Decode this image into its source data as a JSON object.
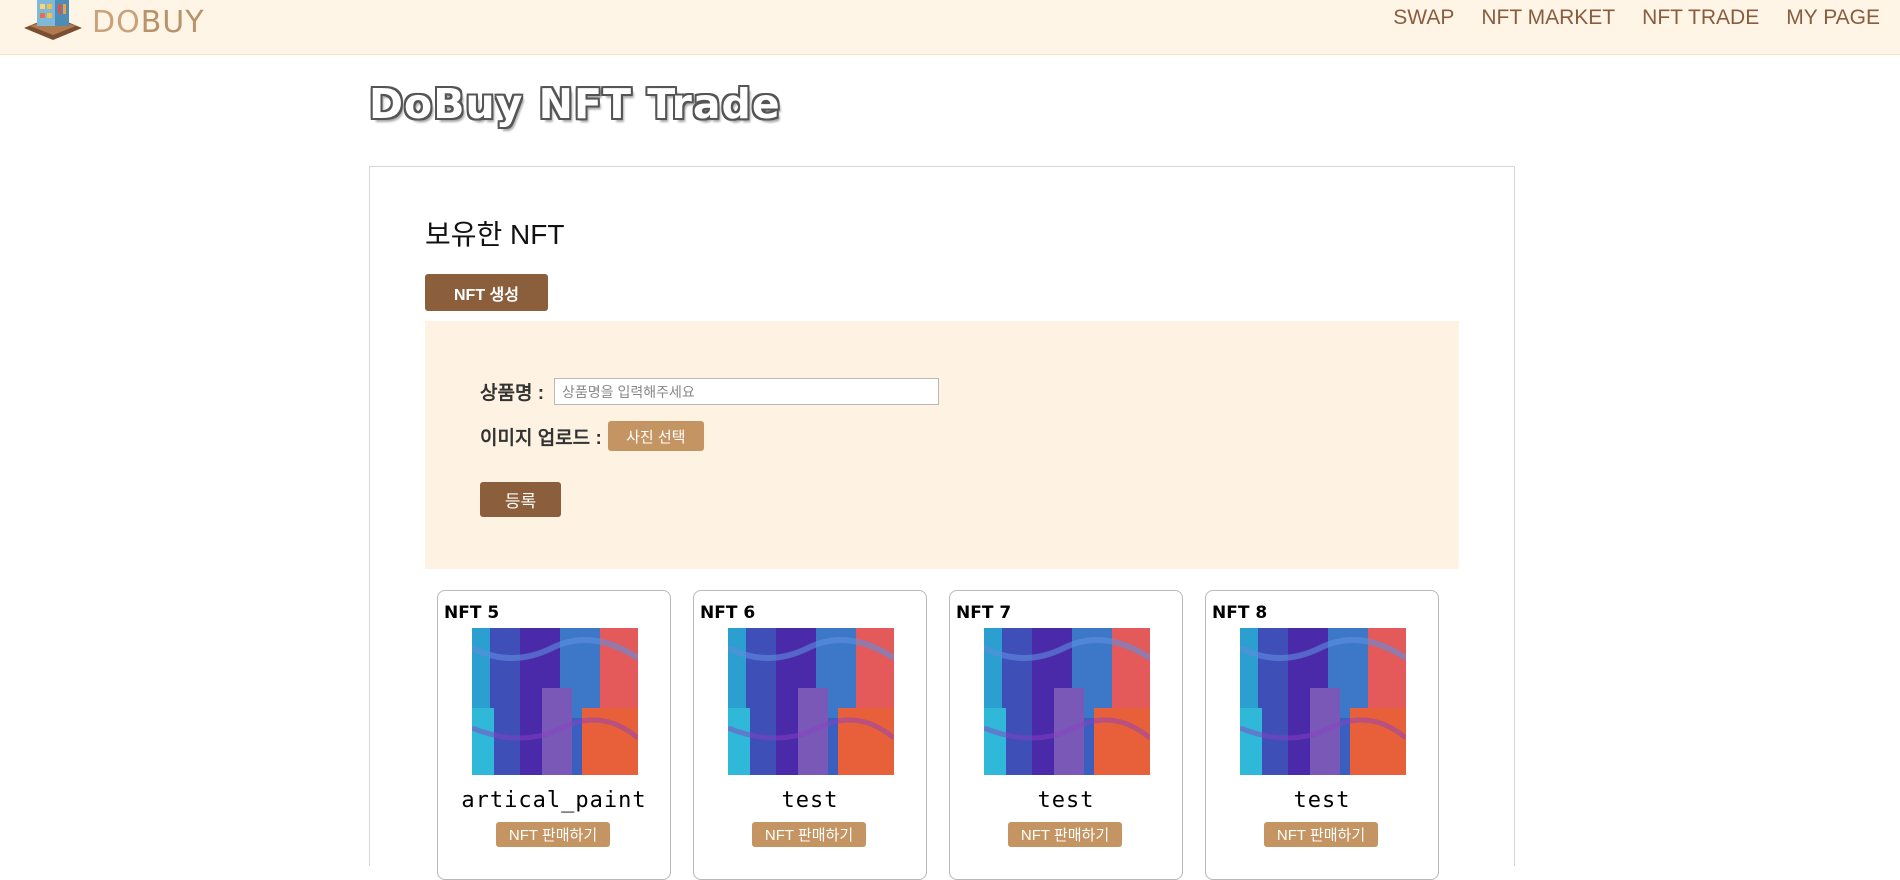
{
  "header": {
    "logo_text_do": "DO",
    "logo_text_buy": "BUY",
    "nav": [
      "SWAP",
      "NFT MARKET",
      "NFT TRADE",
      "MY PAGE"
    ]
  },
  "page": {
    "title": "DoBuy NFT Trade"
  },
  "section": {
    "title": "보유한 NFT",
    "create_button": "NFT 생성"
  },
  "form": {
    "name_label": "상품명 :",
    "name_placeholder": "상품명을 입력해주세요",
    "name_value": "",
    "image_label": "이미지 업로드 :",
    "photo_button": "사진 선택",
    "submit_button": "등록"
  },
  "cards": [
    {
      "id": "NFT 5",
      "name": "artical_paint",
      "button": "NFT 판매하기"
    },
    {
      "id": "NFT 6",
      "name": "test",
      "button": "NFT 판매하기"
    },
    {
      "id": "NFT 7",
      "name": "test",
      "button": "NFT 판매하기"
    },
    {
      "id": "NFT 8",
      "name": "test",
      "button": "NFT 판매하기"
    }
  ],
  "colors": {
    "header_bg": "#fef5e7",
    "brand_brown": "#8b5e3c",
    "brand_tan": "#c49562",
    "form_bg": "#fef3e2"
  }
}
